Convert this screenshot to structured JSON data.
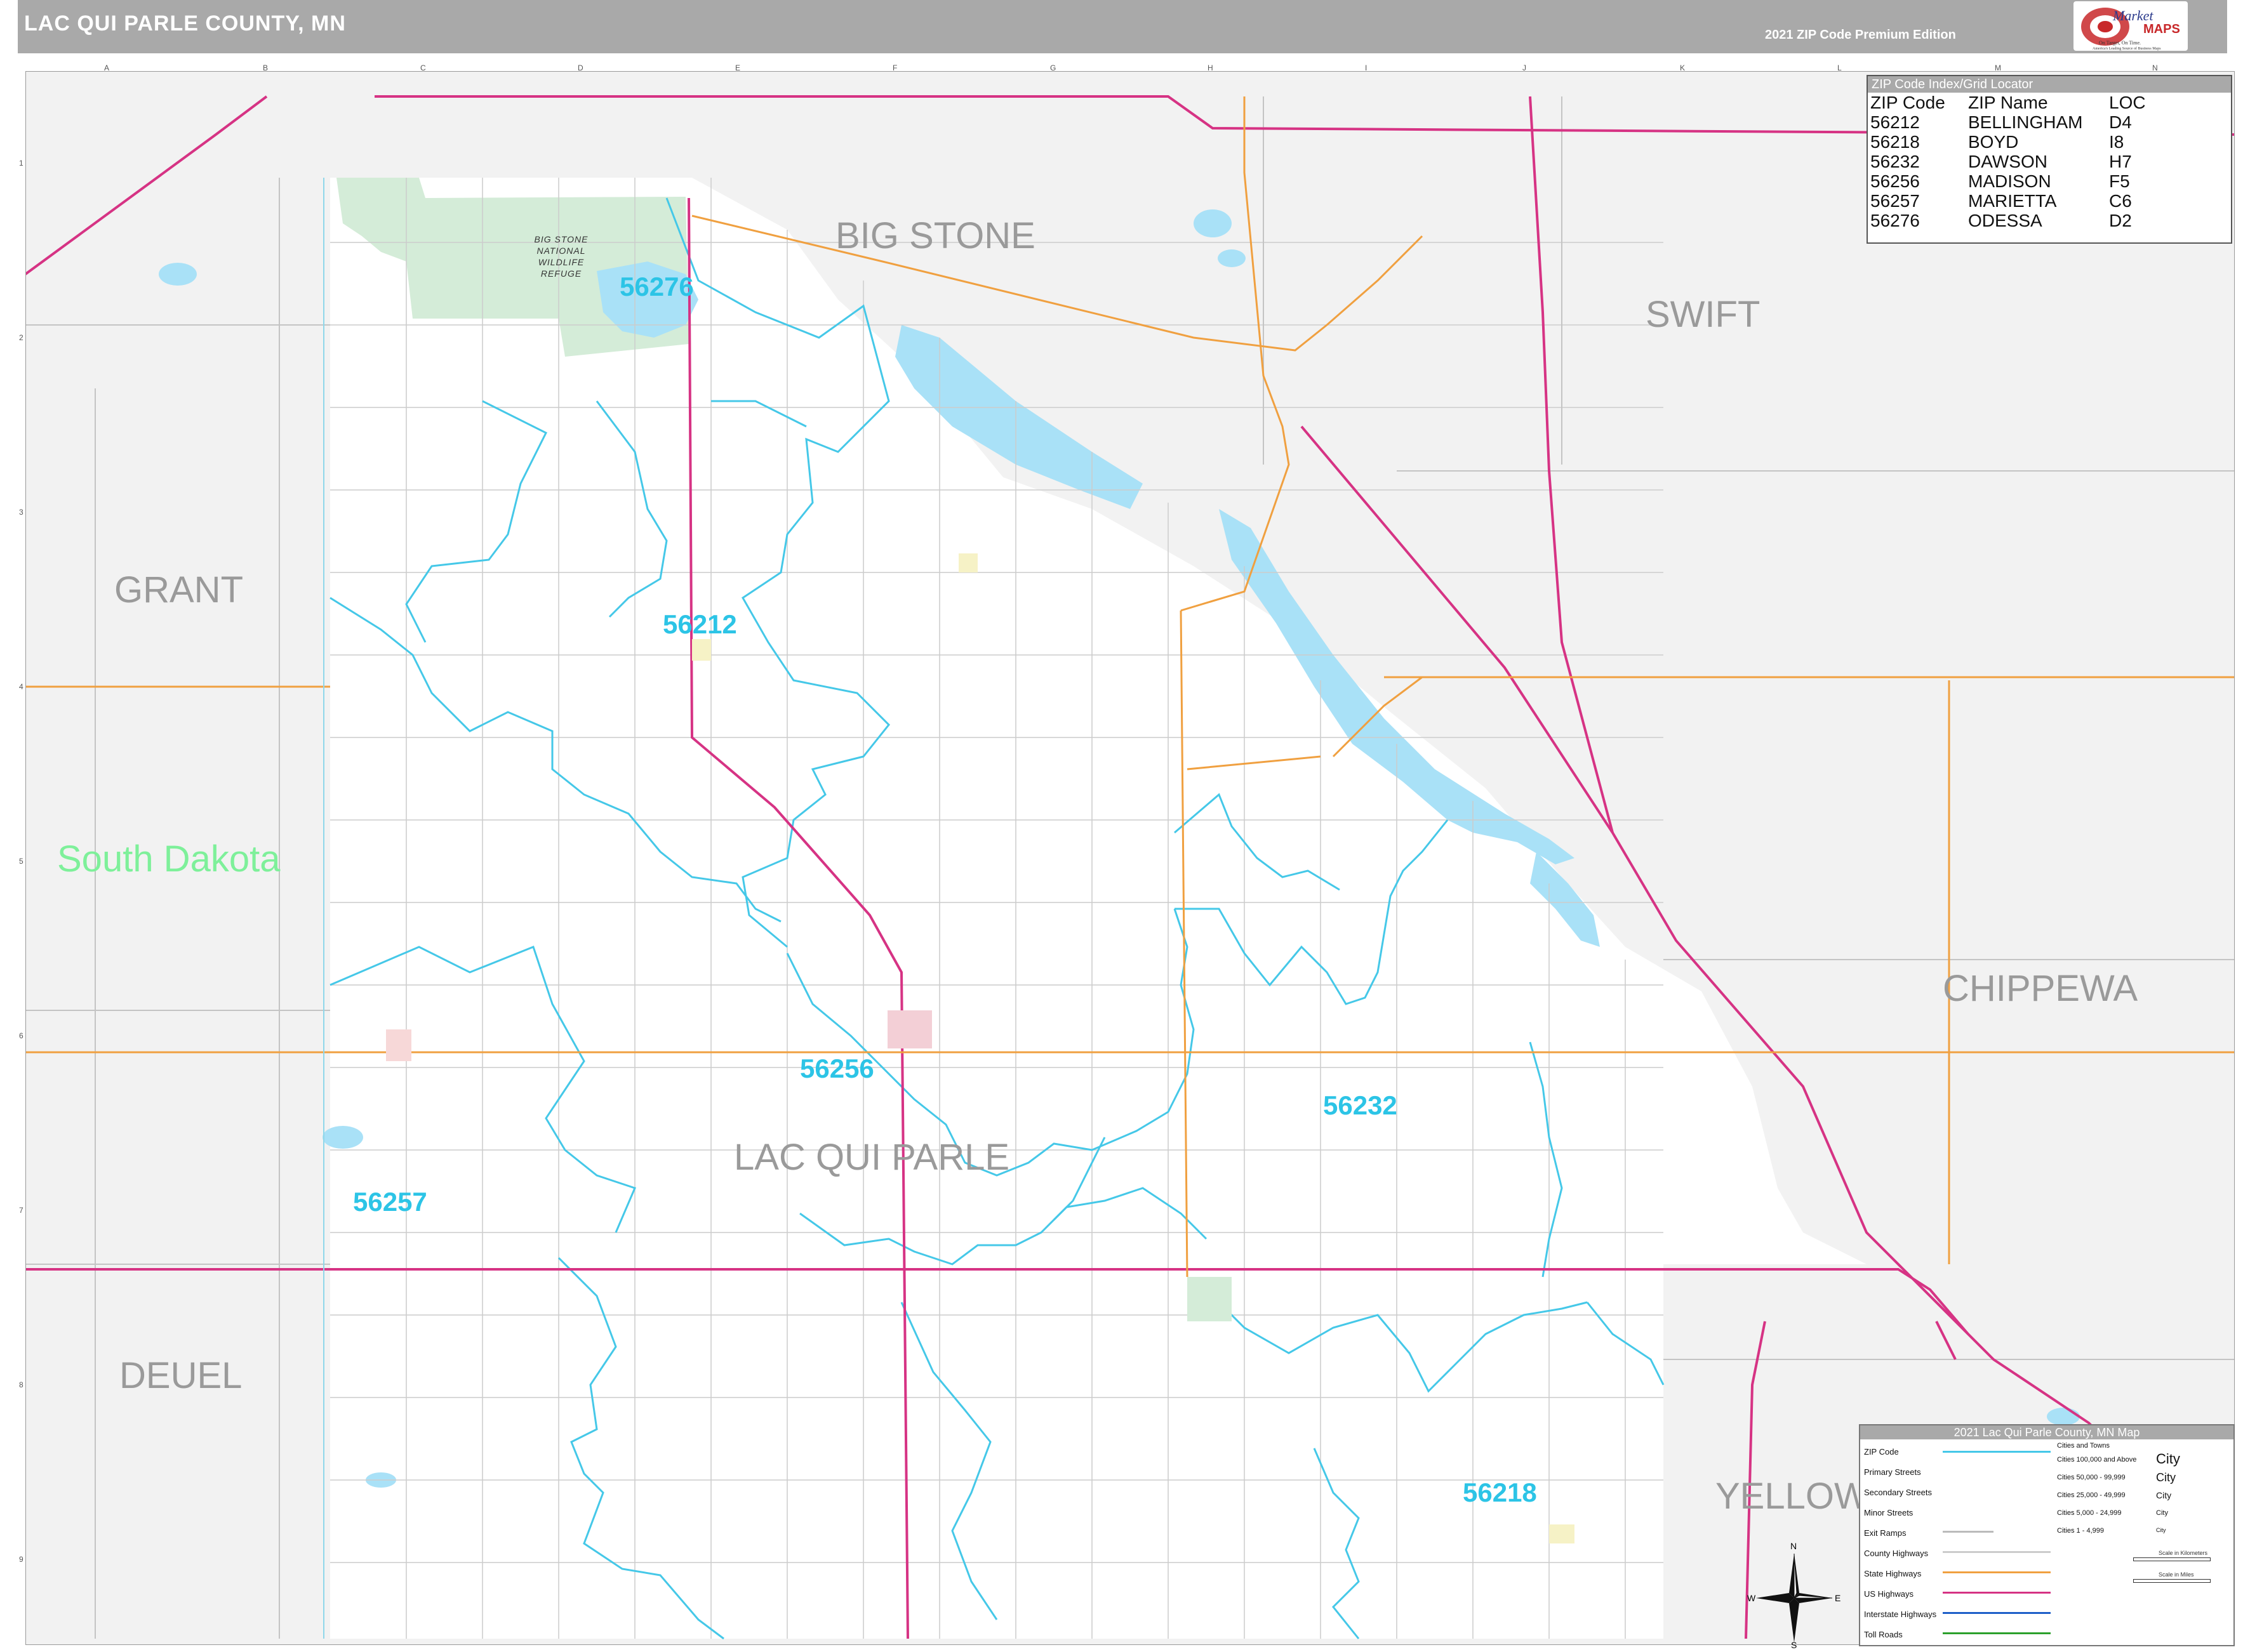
{
  "header": {
    "title": "LAC QUI PARLE COUNTY, MN",
    "edition": "2021 ZIP Code Premium Edition",
    "logo_text": "Market MAPS",
    "logo_tagline": "On Target, On Time. America's Leading Source of Business Maps"
  },
  "map": {
    "county_labels": [
      {
        "name": "BIG STONE"
      },
      {
        "name": "SWIFT"
      },
      {
        "name": "GRANT"
      },
      {
        "name": "CHIPPEWA"
      },
      {
        "name": "LAC QUI PARLE"
      },
      {
        "name": "DEUEL"
      },
      {
        "name": "YELLOW"
      }
    ],
    "state_label": "South Dakota",
    "zip_labels": [
      "56276",
      "56212",
      "56256",
      "56232",
      "56257",
      "56218"
    ],
    "refuge_label": "BIG STONE NATIONAL WILDLIFE REFUGE",
    "grid_columns": [
      "A",
      "B",
      "C",
      "D",
      "E",
      "F",
      "G",
      "H",
      "I",
      "J",
      "K",
      "L",
      "M",
      "N"
    ],
    "grid_rows": [
      "1",
      "2",
      "3",
      "4",
      "5",
      "6",
      "7",
      "8",
      "9"
    ],
    "colors": {
      "zip_boundary": "#45c8e8",
      "zip_label": "#2cc4e6",
      "water": "#a9e1f7",
      "refuge": "#d4ecd8",
      "outside": "#f2f2f2",
      "us_highway": "#d63384",
      "state_highway": "#f0a040",
      "county_label": "#9a9a9a",
      "state_label": "#7ef09a"
    }
  },
  "zip_index": {
    "title": "ZIP Code Index/Grid Locator",
    "headers": [
      "ZIP Code",
      "ZIP Name",
      "LOC"
    ],
    "rows": [
      [
        "56212",
        "BELLINGHAM",
        "D4"
      ],
      [
        "56218",
        "BOYD",
        "I8"
      ],
      [
        "56232",
        "DAWSON",
        "H7"
      ],
      [
        "56256",
        "MADISON",
        "F5"
      ],
      [
        "56257",
        "MARIETTA",
        "C6"
      ],
      [
        "56276",
        "ODESSA",
        "D2"
      ]
    ]
  },
  "legend": {
    "title": "2021 Lac Qui Parle County, MN Map",
    "items": [
      "ZIP Code",
      "Primary Streets",
      "Secondary Streets",
      "Minor Streets",
      "Exit Ramps",
      "County Highways",
      "State Highways",
      "US Highways",
      "Interstate Highways",
      "Toll Roads"
    ],
    "cities_title": "Cities and Towns",
    "city_sizes": [
      "Cities 100,000 and Above",
      "Cities 50,000 - 99,999",
      "Cities 25,000 - 49,999",
      "Cities 5,000 - 24,999",
      "Cities 1 - 4,999"
    ],
    "city_samples": [
      "City",
      "City",
      "City",
      "City",
      "City"
    ],
    "scale_km": "Scale in Kilometers",
    "scale_mi": "Scale in Miles"
  },
  "compass": {
    "n": "N",
    "s": "S",
    "e": "E",
    "w": "W"
  }
}
